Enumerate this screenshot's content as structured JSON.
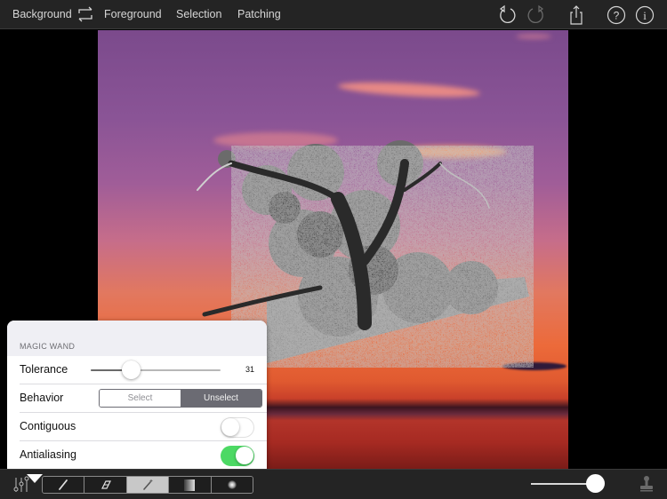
{
  "topbar": {
    "tabs": [
      {
        "label": "Background"
      },
      {
        "label": "Foreground"
      },
      {
        "label": "Selection"
      },
      {
        "label": "Patching"
      }
    ],
    "icons": [
      "swap-icon",
      "undo-icon",
      "redo-icon",
      "share-icon",
      "help-icon",
      "info-icon"
    ]
  },
  "popover": {
    "title": "MAGIC WAND",
    "tolerance": {
      "label": "Tolerance",
      "value": "31",
      "fraction": 0.31
    },
    "behavior": {
      "label": "Behavior",
      "options": [
        "Select",
        "Unselect"
      ],
      "selected": "Unselect"
    },
    "contiguous": {
      "label": "Contiguous",
      "on": false
    },
    "antialiasing": {
      "label": "Antialiasing",
      "on": true
    }
  },
  "bottombar": {
    "tools": [
      "brush-icon",
      "eraser-icon",
      "magic-wand-icon",
      "gradient-icon",
      "soft-brush-icon"
    ],
    "active_tool": "magic-wand-icon",
    "brush_size_fraction": 1.0
  },
  "colors": {
    "toolbar_bg": "#242424",
    "switch_on": "#4cd964",
    "segment_active": "#6b6b73"
  }
}
